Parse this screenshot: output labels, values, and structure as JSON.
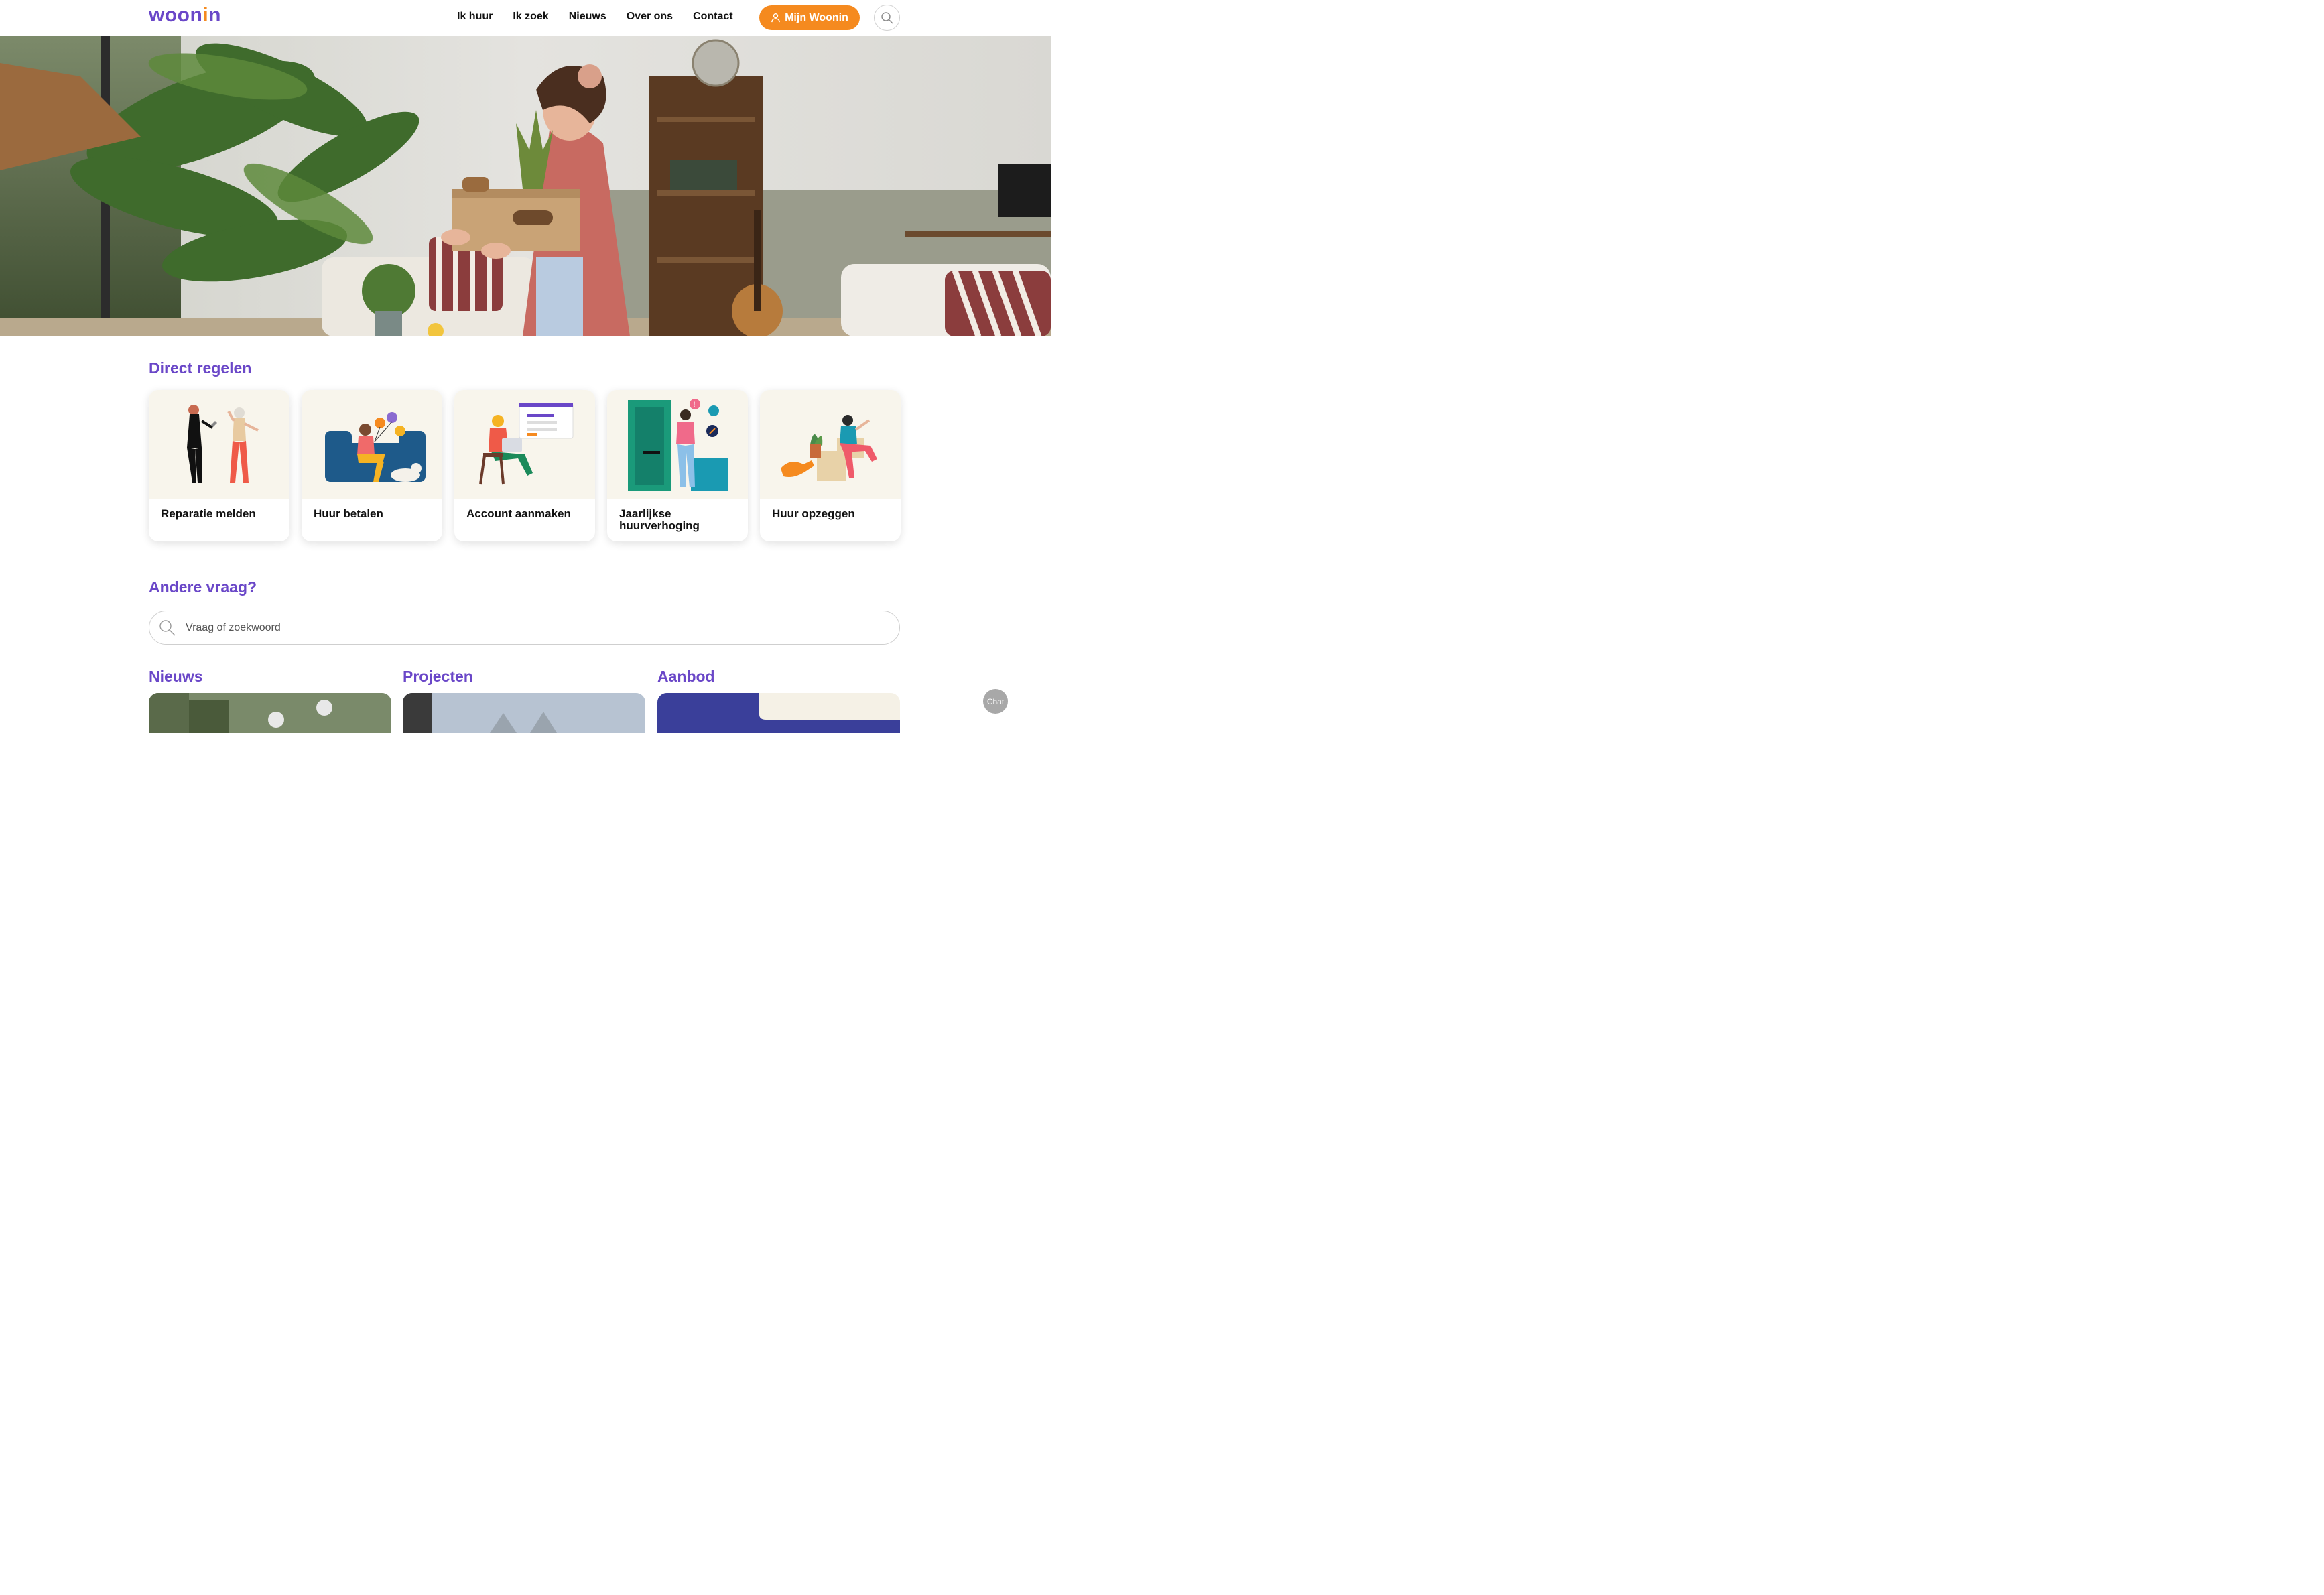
{
  "header": {
    "logo_text": "woon",
    "logo_accent": "i",
    "logo_tail": "n",
    "nav": [
      "Ik huur",
      "Ik zoek",
      "Nieuws",
      "Over ons",
      "Contact"
    ],
    "account_button": "Mijn Woonin",
    "search_icon": "search-icon"
  },
  "direct": {
    "title": "Direct regelen",
    "cards": [
      {
        "label": "Reparatie melden",
        "icon": "repair-illustration"
      },
      {
        "label": "Huur betalen",
        "icon": "payment-illustration"
      },
      {
        "label": "Account aanmaken",
        "icon": "account-illustration"
      },
      {
        "label": "Jaarlijkse huurverhoging",
        "icon": "rent-increase-illustration"
      },
      {
        "label": "Huur opzeggen",
        "icon": "moving-illustration"
      }
    ]
  },
  "other": {
    "title": "Andere vraag?",
    "search_placeholder": "Vraag of zoekwoord"
  },
  "columns": {
    "news_title": "Nieuws",
    "projects_title": "Projecten",
    "offer_title": "Aanbod"
  },
  "chat": {
    "label": "Chat"
  },
  "colors": {
    "brand_purple": "#6a47c8",
    "brand_orange": "#f58a1f"
  }
}
